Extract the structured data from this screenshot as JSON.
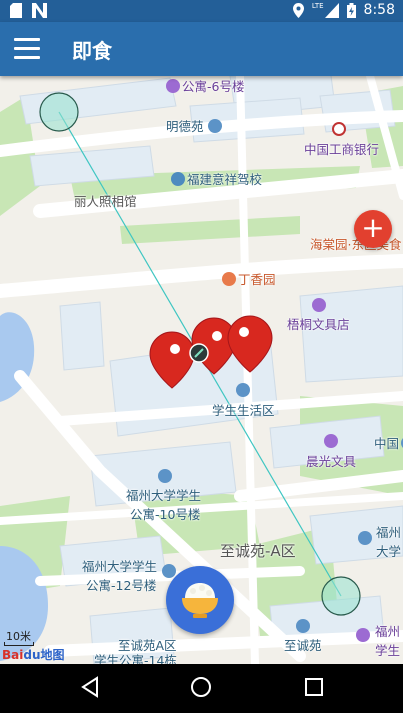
{
  "status_bar": {
    "left_icons": [
      "sd-card-icon",
      "no-signal-icon"
    ],
    "right_icons": [
      "location-pin-icon",
      "signal-lte-icon",
      "battery-charging-icon"
    ],
    "network_label": "LTE",
    "time": "8:58"
  },
  "app_bar": {
    "title": "即食",
    "menu_icon": "hamburger-menu-icon"
  },
  "map": {
    "labels": {
      "apt6": "公寓-6号楼",
      "mingde": "明德苑",
      "icbc": "中国工商银行",
      "fujian_driving": "福建意祥驾校",
      "liren": "丽人照相馆",
      "haitang": "海棠园·东区美食",
      "dingxiang": "丁香园",
      "wutong": "梧桐文具店",
      "student_center": "学生生活区",
      "zhongguo": "中国",
      "chenguang": "晨光文具",
      "apt10_1": "福州大学学生",
      "apt10_2": "公寓-10号楼",
      "fuzhou_right_1": "福州",
      "fuzhou_right_2": "大学",
      "zhicheng_a": "至诚苑-A区",
      "apt12_1": "福州大学学生",
      "apt12_2": "公寓-12号楼",
      "zhicheng": "至诚苑",
      "fuzhou_br_1": "福州",
      "fuzhou_br_2": "学生",
      "zhicheng_a2": "至诚苑A区",
      "apt14": "学生公寓-14栋"
    },
    "scale_label": "10米",
    "logo_text": "Bai",
    "logo_text_2": "du地图",
    "accent_color": "#2a6ead",
    "route_color": "#3fc6c2",
    "marker_color": "#d8281f"
  },
  "buttons": {
    "add_label": "+",
    "bowl_icon": "rice-bowl-icon"
  },
  "nav_bar": {
    "back_icon": "back-triangle-icon",
    "home_icon": "home-circle-icon",
    "recents_icon": "recents-square-icon"
  }
}
